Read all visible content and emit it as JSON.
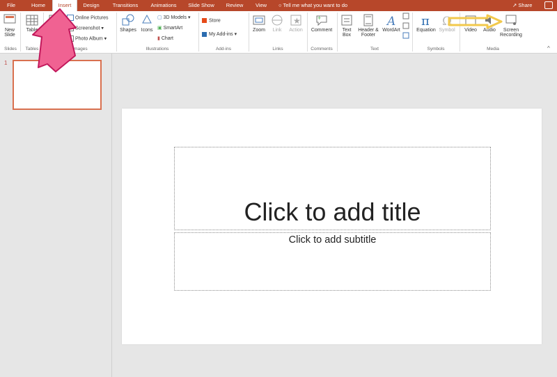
{
  "tabs": [
    {
      "label": "File",
      "active": false
    },
    {
      "label": "Home",
      "active": false
    },
    {
      "label": "Insert",
      "active": true
    },
    {
      "label": "Design",
      "active": false
    },
    {
      "label": "Transitions",
      "active": false
    },
    {
      "label": "Animations",
      "active": false
    },
    {
      "label": "Slide Show",
      "active": false
    },
    {
      "label": "Review",
      "active": false
    },
    {
      "label": "View",
      "active": false
    }
  ],
  "tell_me": "Tell me what you want to do",
  "share": "Share",
  "ribbon": {
    "new_slide": "New Slide",
    "table": "Table",
    "online_pictures": "Online Pictures",
    "screenshot": "Screenshot",
    "photo_album": "Photo Album",
    "shapes": "Shapes",
    "icons": "Icons",
    "models_3d": "3D Models",
    "smartart": "SmartArt",
    "chart": "Chart",
    "store": "Store",
    "my_addins": "My Add-ins",
    "zoom": "Zoom",
    "link": "Link",
    "action": "Action",
    "comment": "Comment",
    "text_box": "Text Box",
    "header_footer": "Header & Footer",
    "wordart": "WordArt",
    "equation": "Equation",
    "symbol": "Symbol",
    "video": "Video",
    "audio": "Audio",
    "screen_recording": "Screen Recording"
  },
  "groups": {
    "slides": "Slides",
    "tables": "Tables",
    "images": "Images",
    "illustrations": "Illustrations",
    "addins": "Add-ins",
    "links": "Links",
    "comments": "Comments",
    "text": "Text",
    "symbols": "Symbols",
    "media": "Media"
  },
  "thumbnail_number": "1",
  "slide": {
    "title_placeholder": "Click to add title",
    "subtitle_placeholder": "Click to add subtitle"
  },
  "colors": {
    "accent": "#b7472a",
    "annotation_arrow": "#f06292",
    "annotation_highlight": "#f2c94c"
  }
}
